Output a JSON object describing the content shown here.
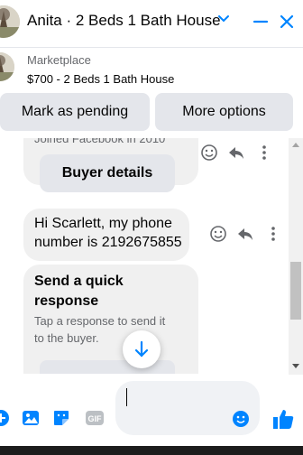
{
  "header": {
    "title": "Anita · 2 Beds 1 Bath House",
    "chevron_icon": "chevron-down-icon",
    "minimize_icon": "minimize-icon",
    "close_icon": "close-icon",
    "accent": "#0084ff"
  },
  "marketplace": {
    "label": "Marketplace",
    "listing": "$700 - 2 Beds 1 Bath House",
    "mark_pending_label": "Mark as pending",
    "more_options_label": "More options"
  },
  "messages": {
    "cut_off_text": "Joined Facebook in 2010",
    "buyer_details_label": "Buyer details",
    "phone_message": "Hi Scarlett, my phone number is 2192675855",
    "quick_response_title": "Send a quick response",
    "quick_response_sub": "Tap a response to send it to the buyer."
  },
  "composer": {
    "placeholder": "",
    "icons": [
      "plus-icon",
      "photo-icon",
      "sticker-icon",
      "gif-icon",
      "emoji-icon",
      "like-icon"
    ]
  }
}
